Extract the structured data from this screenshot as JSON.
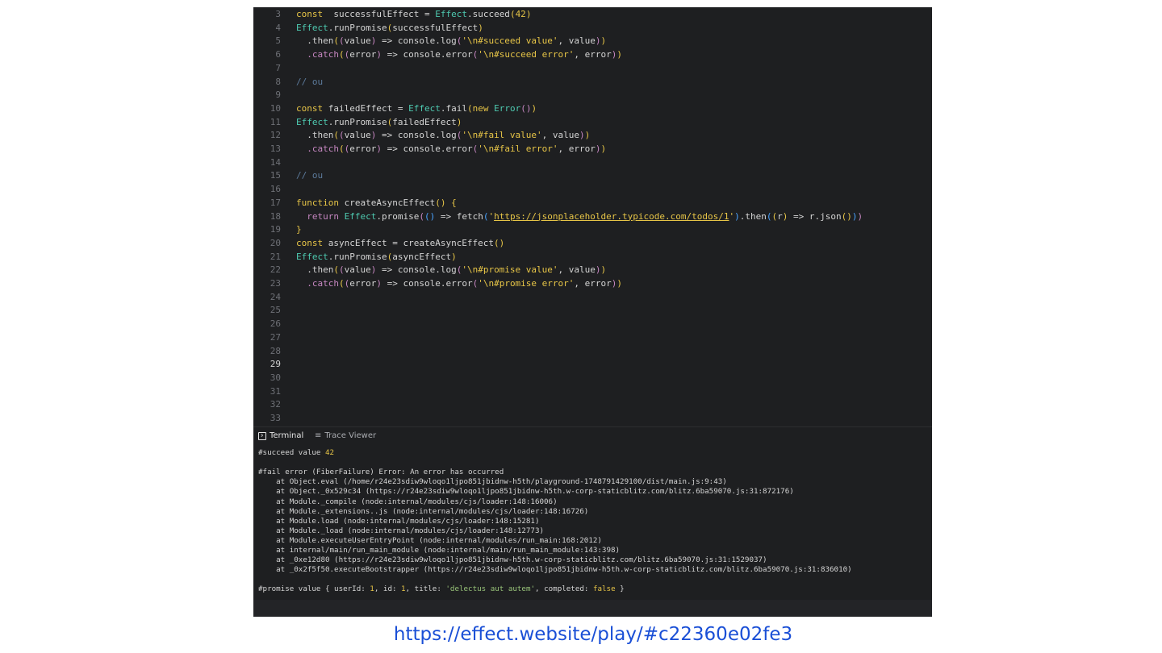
{
  "editor": {
    "lines": [
      {
        "n": "3",
        "tokens": [
          [
            "kw",
            "const"
          ],
          [
            "",
            "  successfulEffect = "
          ],
          [
            "ty",
            "Effect"
          ],
          [
            "",
            ".succeed"
          ],
          [
            "p1",
            "("
          ],
          [
            "num",
            "42"
          ],
          [
            "p1",
            ")"
          ]
        ]
      },
      {
        "n": "4",
        "tokens": [
          [
            "ty",
            "Effect"
          ],
          [
            "",
            ".runPromise"
          ],
          [
            "p1",
            "("
          ],
          [
            "",
            "successfulEffect"
          ],
          [
            "p1",
            ")"
          ]
        ]
      },
      {
        "n": "5",
        "tokens": [
          [
            "",
            "  .then"
          ],
          [
            "p1",
            "("
          ],
          [
            "p2",
            "("
          ],
          [
            "",
            "value"
          ],
          [
            "p2",
            ")"
          ],
          [
            "",
            " => console.log"
          ],
          [
            "p2",
            "("
          ],
          [
            "str",
            "'\\n#succeed value'"
          ],
          [
            "",
            ", value"
          ],
          [
            "p2",
            ")"
          ],
          [
            "p1",
            ")"
          ]
        ]
      },
      {
        "n": "6",
        "tokens": [
          [
            "p2",
            "  .catch"
          ],
          [
            "p1",
            "("
          ],
          [
            "p2",
            "("
          ],
          [
            "",
            "error"
          ],
          [
            "p2",
            ")"
          ],
          [
            "",
            " => console.error"
          ],
          [
            "p2",
            "("
          ],
          [
            "str",
            "'\\n#succeed error'"
          ],
          [
            "",
            ", error"
          ],
          [
            "p2",
            ")"
          ],
          [
            "p1",
            ")"
          ]
        ]
      },
      {
        "n": "7",
        "tokens": []
      },
      {
        "n": "8",
        "tokens": [
          [
            "cm",
            "// ou"
          ]
        ]
      },
      {
        "n": "9",
        "tokens": []
      },
      {
        "n": "10",
        "tokens": [
          [
            "kw",
            "const"
          ],
          [
            "",
            " failedEffect = "
          ],
          [
            "ty",
            "Effect"
          ],
          [
            "",
            ".fail"
          ],
          [
            "p1",
            "("
          ],
          [
            "kw",
            "new"
          ],
          [
            "",
            " "
          ],
          [
            "ty",
            "Error"
          ],
          [
            "p2",
            "()"
          ],
          [
            "p1",
            ")"
          ]
        ]
      },
      {
        "n": "11",
        "tokens": [
          [
            "ty",
            "Effect"
          ],
          [
            "",
            ".runPromise"
          ],
          [
            "p1",
            "("
          ],
          [
            "",
            "failedEffect"
          ],
          [
            "p1",
            ")"
          ]
        ]
      },
      {
        "n": "12",
        "tokens": [
          [
            "",
            "  .then"
          ],
          [
            "p1",
            "("
          ],
          [
            "p2",
            "("
          ],
          [
            "",
            "value"
          ],
          [
            "p2",
            ")"
          ],
          [
            "",
            " => console.log"
          ],
          [
            "p2",
            "("
          ],
          [
            "str",
            "'\\n#fail value'"
          ],
          [
            "",
            ", value"
          ],
          [
            "p2",
            ")"
          ],
          [
            "p1",
            ")"
          ]
        ]
      },
      {
        "n": "13",
        "tokens": [
          [
            "p2",
            "  .catch"
          ],
          [
            "p1",
            "("
          ],
          [
            "p2",
            "("
          ],
          [
            "",
            "error"
          ],
          [
            "p2",
            ")"
          ],
          [
            "",
            " => console.error"
          ],
          [
            "p2",
            "("
          ],
          [
            "str",
            "'\\n#fail error'"
          ],
          [
            "",
            ", error"
          ],
          [
            "p2",
            ")"
          ],
          [
            "p1",
            ")"
          ]
        ]
      },
      {
        "n": "14",
        "tokens": []
      },
      {
        "n": "15",
        "tokens": [
          [
            "cm",
            "// ou"
          ]
        ]
      },
      {
        "n": "16",
        "tokens": []
      },
      {
        "n": "17",
        "tokens": [
          [
            "kw",
            "function"
          ],
          [
            "",
            " createAsyncEffect"
          ],
          [
            "p1",
            "()"
          ],
          [
            "",
            " "
          ],
          [
            "p1",
            "{"
          ]
        ]
      },
      {
        "n": "18",
        "tokens": [
          [
            "p2",
            "  return"
          ],
          [
            "",
            " "
          ],
          [
            "ty",
            "Effect"
          ],
          [
            "",
            ".promise"
          ],
          [
            "p2",
            "("
          ],
          [
            "p3",
            "()"
          ],
          [
            "",
            " => fetch"
          ],
          [
            "p3",
            "("
          ],
          [
            "str",
            "'"
          ],
          [
            "url",
            "https://jsonplaceholder.typicode.com/todos/1"
          ],
          [
            "str",
            "'"
          ],
          [
            "p3",
            ")"
          ],
          [
            "",
            ".then"
          ],
          [
            "p3",
            "("
          ],
          [
            "p1",
            "("
          ],
          [
            "",
            "r"
          ],
          [
            "p1",
            ")"
          ],
          [
            "",
            " => r.json"
          ],
          [
            "p1",
            "()"
          ],
          [
            "p3",
            ")"
          ],
          [
            "p2",
            ")"
          ]
        ]
      },
      {
        "n": "19",
        "tokens": [
          [
            "p1",
            "}"
          ]
        ]
      },
      {
        "n": "20",
        "tokens": [
          [
            "kw",
            "const"
          ],
          [
            "",
            " asyncEffect = createAsyncEffect"
          ],
          [
            "p1",
            "()"
          ]
        ]
      },
      {
        "n": "21",
        "tokens": [
          [
            "ty",
            "Effect"
          ],
          [
            "",
            ".runPromise"
          ],
          [
            "p1",
            "("
          ],
          [
            "",
            "asyncEffect"
          ],
          [
            "p1",
            ")"
          ]
        ]
      },
      {
        "n": "22",
        "tokens": [
          [
            "",
            "  .then"
          ],
          [
            "p1",
            "("
          ],
          [
            "p2",
            "("
          ],
          [
            "",
            "value"
          ],
          [
            "p2",
            ")"
          ],
          [
            "",
            " => console.log"
          ],
          [
            "p2",
            "("
          ],
          [
            "str",
            "'\\n#promise value'"
          ],
          [
            "",
            ", value"
          ],
          [
            "p2",
            ")"
          ],
          [
            "p1",
            ")"
          ]
        ]
      },
      {
        "n": "23",
        "tokens": [
          [
            "p2",
            "  .catch"
          ],
          [
            "p1",
            "("
          ],
          [
            "p2",
            "("
          ],
          [
            "",
            "error"
          ],
          [
            "p2",
            ")"
          ],
          [
            "",
            " => console.error"
          ],
          [
            "p2",
            "("
          ],
          [
            "str",
            "'\\n#promise error'"
          ],
          [
            "",
            ", error"
          ],
          [
            "p2",
            ")"
          ],
          [
            "p1",
            ")"
          ]
        ]
      },
      {
        "n": "24",
        "tokens": []
      },
      {
        "n": "25",
        "tokens": []
      },
      {
        "n": "26",
        "tokens": []
      },
      {
        "n": "27",
        "tokens": []
      },
      {
        "n": "28",
        "tokens": []
      },
      {
        "n": "29",
        "tokens": [],
        "active": true
      },
      {
        "n": "30",
        "tokens": []
      },
      {
        "n": "31",
        "tokens": []
      },
      {
        "n": "32",
        "tokens": []
      },
      {
        "n": "33",
        "tokens": []
      }
    ]
  },
  "panel": {
    "tabs": [
      {
        "label": "Terminal",
        "icon": "terminal-icon",
        "active": true
      },
      {
        "label": "Trace Viewer",
        "icon": "trace-icon",
        "active": false
      }
    ]
  },
  "terminal": {
    "lines": [
      [
        [
          "",
          "#succeed value "
        ],
        [
          "tnum",
          "42"
        ]
      ],
      [],
      [
        [
          "",
          "#fail error (FiberFailure) Error: An error has occurred"
        ]
      ],
      [
        [
          "",
          "    at Object.eval (/home/r24e23sdiw9wloqo1ljpo851jbidnw-h5th/playground-1748791429100/dist/main.js:9:43)"
        ]
      ],
      [
        [
          "",
          "    at Object._0x529c34 (https://r24e23sdiw9wloqo1ljpo851jbidnw-h5th.w-corp-staticblitz.com/blitz.6ba59070.js:31:872176)"
        ]
      ],
      [
        [
          "",
          "    at Module._compile (node:internal/modules/cjs/loader:148:16006)"
        ]
      ],
      [
        [
          "",
          "    at Module._extensions..js (node:internal/modules/cjs/loader:148:16726)"
        ]
      ],
      [
        [
          "",
          "    at Module.load (node:internal/modules/cjs/loader:148:15281)"
        ]
      ],
      [
        [
          "",
          "    at Module._load (node:internal/modules/cjs/loader:148:12773)"
        ]
      ],
      [
        [
          "",
          "    at Module.executeUserEntryPoint (node:internal/modules/run_main:168:2012)"
        ]
      ],
      [
        [
          "",
          "    at internal/main/run_main_module (node:internal/main/run_main_module:143:398)"
        ]
      ],
      [
        [
          "",
          "    at _0xe12d80 (https://r24e23sdiw9wloqo1ljpo851jbidnw-h5th.w-corp-staticblitz.com/blitz.6ba59070.js:31:1529037)"
        ]
      ],
      [
        [
          "",
          "    at _0x2f5f50.executeBootstrapper (https://r24e23sdiw9wloqo1ljpo851jbidnw-h5th.w-corp-staticblitz.com/blitz.6ba59070.js:31:836010)"
        ]
      ],
      [],
      [
        [
          "",
          "#promise value { userId: "
        ],
        [
          "tnum",
          "1"
        ],
        [
          "",
          ", id: "
        ],
        [
          "tnum",
          "1"
        ],
        [
          "",
          ", title: "
        ],
        [
          "tstr",
          "'delectus aut autem'"
        ],
        [
          "",
          ", completed: "
        ],
        [
          "tbool",
          "false"
        ],
        [
          "",
          " }"
        ]
      ]
    ]
  },
  "footer": {
    "link": "https://effect.website/play/#c22360e02fe3"
  }
}
